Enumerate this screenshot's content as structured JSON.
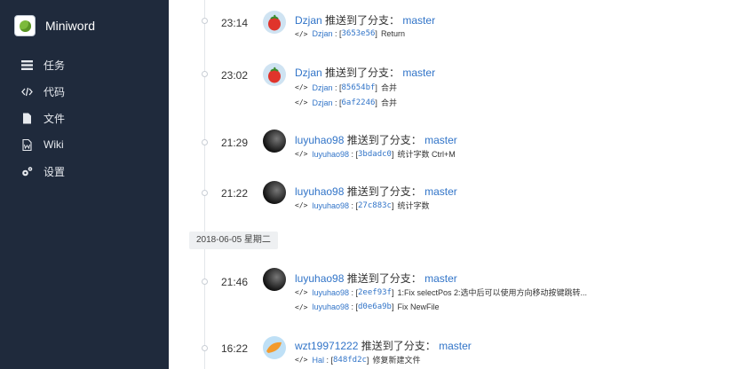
{
  "app": {
    "name": "Miniword"
  },
  "sidebar": {
    "items": [
      {
        "label": "任务",
        "icon": "task-list-icon"
      },
      {
        "label": "代码",
        "icon": "code-icon"
      },
      {
        "label": "文件",
        "icon": "file-icon"
      },
      {
        "label": "Wiki",
        "icon": "wiki-icon"
      },
      {
        "label": "设置",
        "icon": "settings-gear-icon"
      }
    ]
  },
  "timeline": {
    "pushed_text": "推送到了分支：",
    "date_separator": "2018-06-05 星期二",
    "entries": [
      {
        "time": "23:14",
        "user": "Dzjan",
        "branch": "master",
        "avatar": "pepper-avatar",
        "commits": [
          {
            "author": "Dzjan",
            "sha": "3653e56",
            "message": "Return"
          }
        ]
      },
      {
        "time": "23:02",
        "user": "Dzjan",
        "branch": "master",
        "avatar": "pepper-avatar",
        "commits": [
          {
            "author": "Dzjan",
            "sha": "85654bf",
            "message": "合并"
          },
          {
            "author": "Dzjan",
            "sha": "6af2246",
            "message": "合并"
          }
        ]
      },
      {
        "time": "21:29",
        "user": "luyuhao98",
        "branch": "master",
        "avatar": "photo-avatar",
        "commits": [
          {
            "author": "luyuhao98",
            "sha": "3bdadc0",
            "message": "统计字数 Ctrl+M"
          }
        ]
      },
      {
        "time": "21:22",
        "user": "luyuhao98",
        "branch": "master",
        "avatar": "photo-avatar",
        "commits": [
          {
            "author": "luyuhao98",
            "sha": "27c883c",
            "message": "统计字数"
          }
        ]
      },
      {
        "time": "21:46",
        "user": "luyuhao98",
        "branch": "master",
        "avatar": "photo-avatar",
        "commits": [
          {
            "author": "luyuhao98",
            "sha": "2eef93f",
            "message": "1:Fix selectPos 2:选中后可以使用方向移动按键跳转..."
          },
          {
            "author": "luyuhao98",
            "sha": "d0e6a9b",
            "message": "Fix NewFile"
          }
        ]
      },
      {
        "time": "16:22",
        "user": "wzt19971222",
        "branch": "master",
        "avatar": "orange-avatar",
        "commits": [
          {
            "author": "Hal",
            "sha": "848fd2c",
            "message": "修复新建文件"
          }
        ]
      }
    ]
  }
}
